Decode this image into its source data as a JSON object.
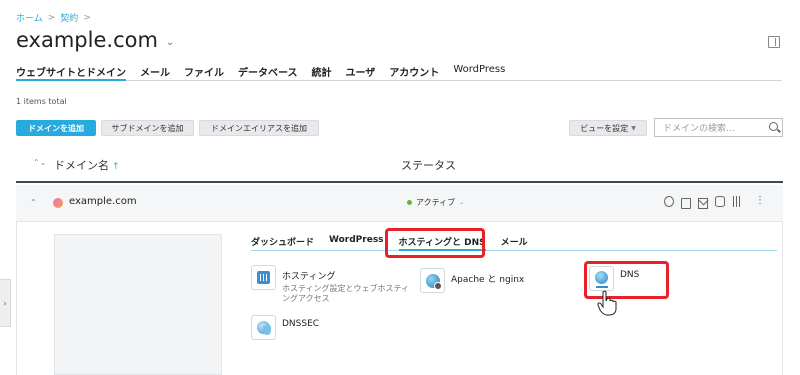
{
  "breadcrumb": {
    "home": "ホーム",
    "contracts": "契約",
    "sep": ">"
  },
  "page": {
    "title": "example.com"
  },
  "tabs": [
    {
      "label": "ウェブサイトとドメイン"
    },
    {
      "label": "メール"
    },
    {
      "label": "ファイル"
    },
    {
      "label": "データベース"
    },
    {
      "label": "統計"
    },
    {
      "label": "ユーザ"
    },
    {
      "label": "アカウント"
    },
    {
      "label": "WordPress"
    }
  ],
  "list": {
    "count": "1 items total",
    "add_domain": "ドメインを追加",
    "add_subdomain": "サブドメインを追加",
    "add_alias": "ドメインエイリアスを追加",
    "view_settings": "ビューを設定",
    "search_placeholder": "ドメインの検索..."
  },
  "table": {
    "col_name": "ドメイン名",
    "col_status": "ステータス"
  },
  "row": {
    "domain": "example.com",
    "status": "アクティブ"
  },
  "subtabs": [
    {
      "label": "ダッシュボード"
    },
    {
      "label": "WordPress"
    },
    {
      "label": "ホスティングと DNS"
    },
    {
      "label": "メール"
    }
  ],
  "tools": {
    "hosting": {
      "label": "ホスティング",
      "desc": "ホスティング設定とウェブホスティングアクセス",
      "icon": "hosting-settings-icon"
    },
    "apache": {
      "label": "Apache と nginx",
      "icon": "apache-nginx-icon"
    },
    "dns": {
      "label": "DNS",
      "icon": "dns-icon"
    },
    "dnssec": {
      "label": "DNSSEC",
      "icon": "dnssec-icon"
    }
  },
  "colors": {
    "accent": "#28aade",
    "highlight": "#e8202a",
    "active": "#6ab537"
  }
}
